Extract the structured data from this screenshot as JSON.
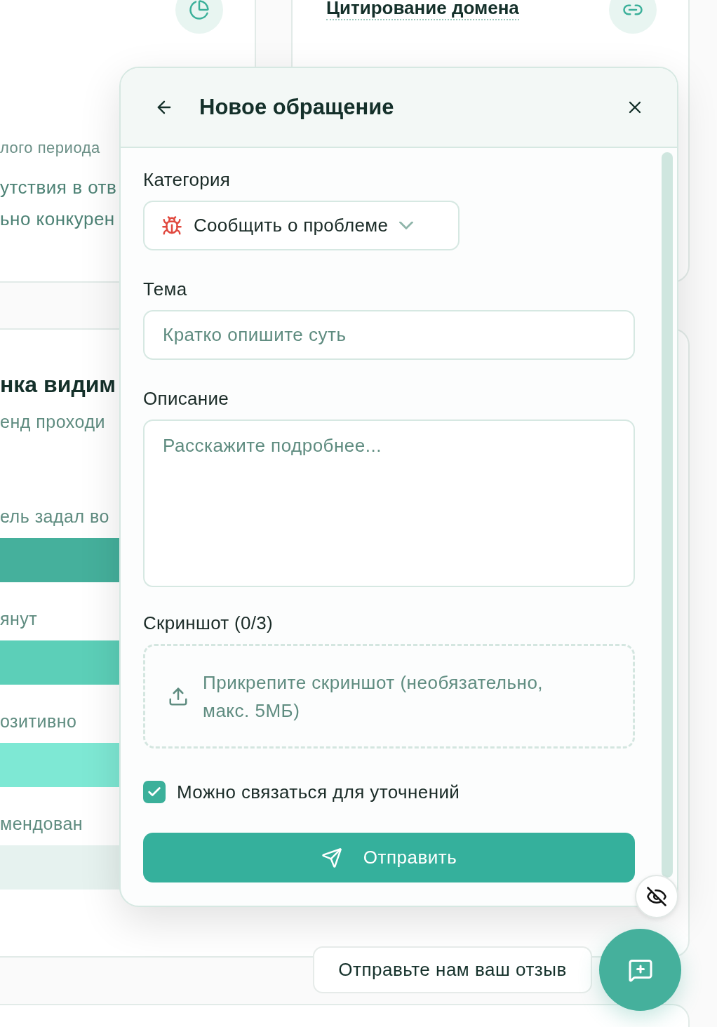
{
  "background": {
    "summary_card": {
      "texts": [
        "лого периода",
        "утствия в отв",
        "ьно конкурен"
      ]
    },
    "citation_card": {
      "title": "Цитирование домена"
    },
    "visibility_card": {
      "title": "нка видим",
      "subtitle": "енд проходи",
      "rows": [
        {
          "label": "ель задал во",
          "color": "#45b09c"
        },
        {
          "label": "янут",
          "color": "#5ccfb8"
        },
        {
          "label": "озитивно",
          "color": "#7ee8d4"
        },
        {
          "label": "мендован",
          "color": "#e6f2ef"
        }
      ]
    }
  },
  "dialog": {
    "title": "Новое обращение",
    "category": {
      "label": "Категория",
      "value": "Сообщить о проблеме"
    },
    "topic": {
      "label": "Тема",
      "placeholder": "Кратко опишите суть"
    },
    "description": {
      "label": "Описание",
      "placeholder": "Расскажите подробнее..."
    },
    "screenshot": {
      "label": "Скриншот (0/3)",
      "hint": "Прикрепите скриншот (необязательно, макс. 5МБ)"
    },
    "consent": {
      "label": "Можно связаться для уточнений",
      "checked": true
    },
    "submit": "Отправить"
  },
  "feedback_prompt": "Отправьте нам ваш отзыв"
}
